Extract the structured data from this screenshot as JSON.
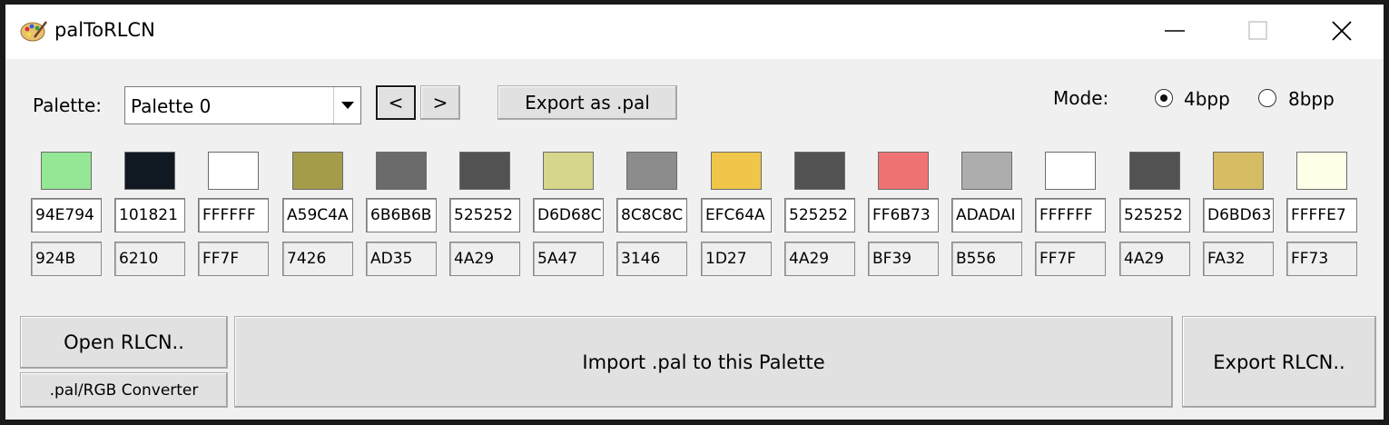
{
  "window": {
    "title": "palToRLCN"
  },
  "toolbar": {
    "palette_label": "Palette:",
    "palette_selected": "Palette 0",
    "prev_label": "<",
    "next_label": ">",
    "export_pal_label": "Export as .pal",
    "mode_label": "Mode:",
    "mode_options": [
      "4bpp",
      "8bpp"
    ],
    "mode_selected": "4bpp"
  },
  "colors": [
    {
      "hex": "94E794",
      "code": "924B",
      "swatch": "#94E794"
    },
    {
      "hex": "101821",
      "code": "6210",
      "swatch": "#101821"
    },
    {
      "hex": "FFFFFF",
      "code": "FF7F",
      "swatch": "#FFFFFF"
    },
    {
      "hex": "A59C4A",
      "code": "7426",
      "swatch": "#A59C4A"
    },
    {
      "hex": "6B6B6B",
      "code": "AD35",
      "swatch": "#6B6B6B"
    },
    {
      "hex": "525252",
      "code": "4A29",
      "swatch": "#525252"
    },
    {
      "hex": "D6D68C",
      "code": "5A47",
      "swatch": "#D6D68C"
    },
    {
      "hex": "8C8C8C",
      "code": "3146",
      "swatch": "#8C8C8C"
    },
    {
      "hex": "EFC64A",
      "code": "1D27",
      "swatch": "#EFC64A"
    },
    {
      "hex": "525252",
      "code": "4A29",
      "swatch": "#525252"
    },
    {
      "hex": "FF6B73",
      "code": "BF39",
      "swatch": "#EF7373"
    },
    {
      "hex": "ADADAI",
      "code": "B556",
      "swatch": "#ADADAD"
    },
    {
      "hex": "FFFFFF",
      "code": "FF7F",
      "swatch": "#FFFFFF"
    },
    {
      "hex": "525252",
      "code": "4A29",
      "swatch": "#525252"
    },
    {
      "hex": "D6BD63",
      "code": "FA32",
      "swatch": "#D6BD63"
    },
    {
      "hex": "FFFFE7",
      "code": "FF73",
      "swatch": "#FFFFE7"
    }
  ],
  "actions": {
    "open_rlcn_label": "Open RLCN..",
    "converter_label": ".pal/RGB Converter",
    "import_pal_label": "Import .pal to this Palette",
    "export_rlcn_label": "Export RLCN.."
  }
}
